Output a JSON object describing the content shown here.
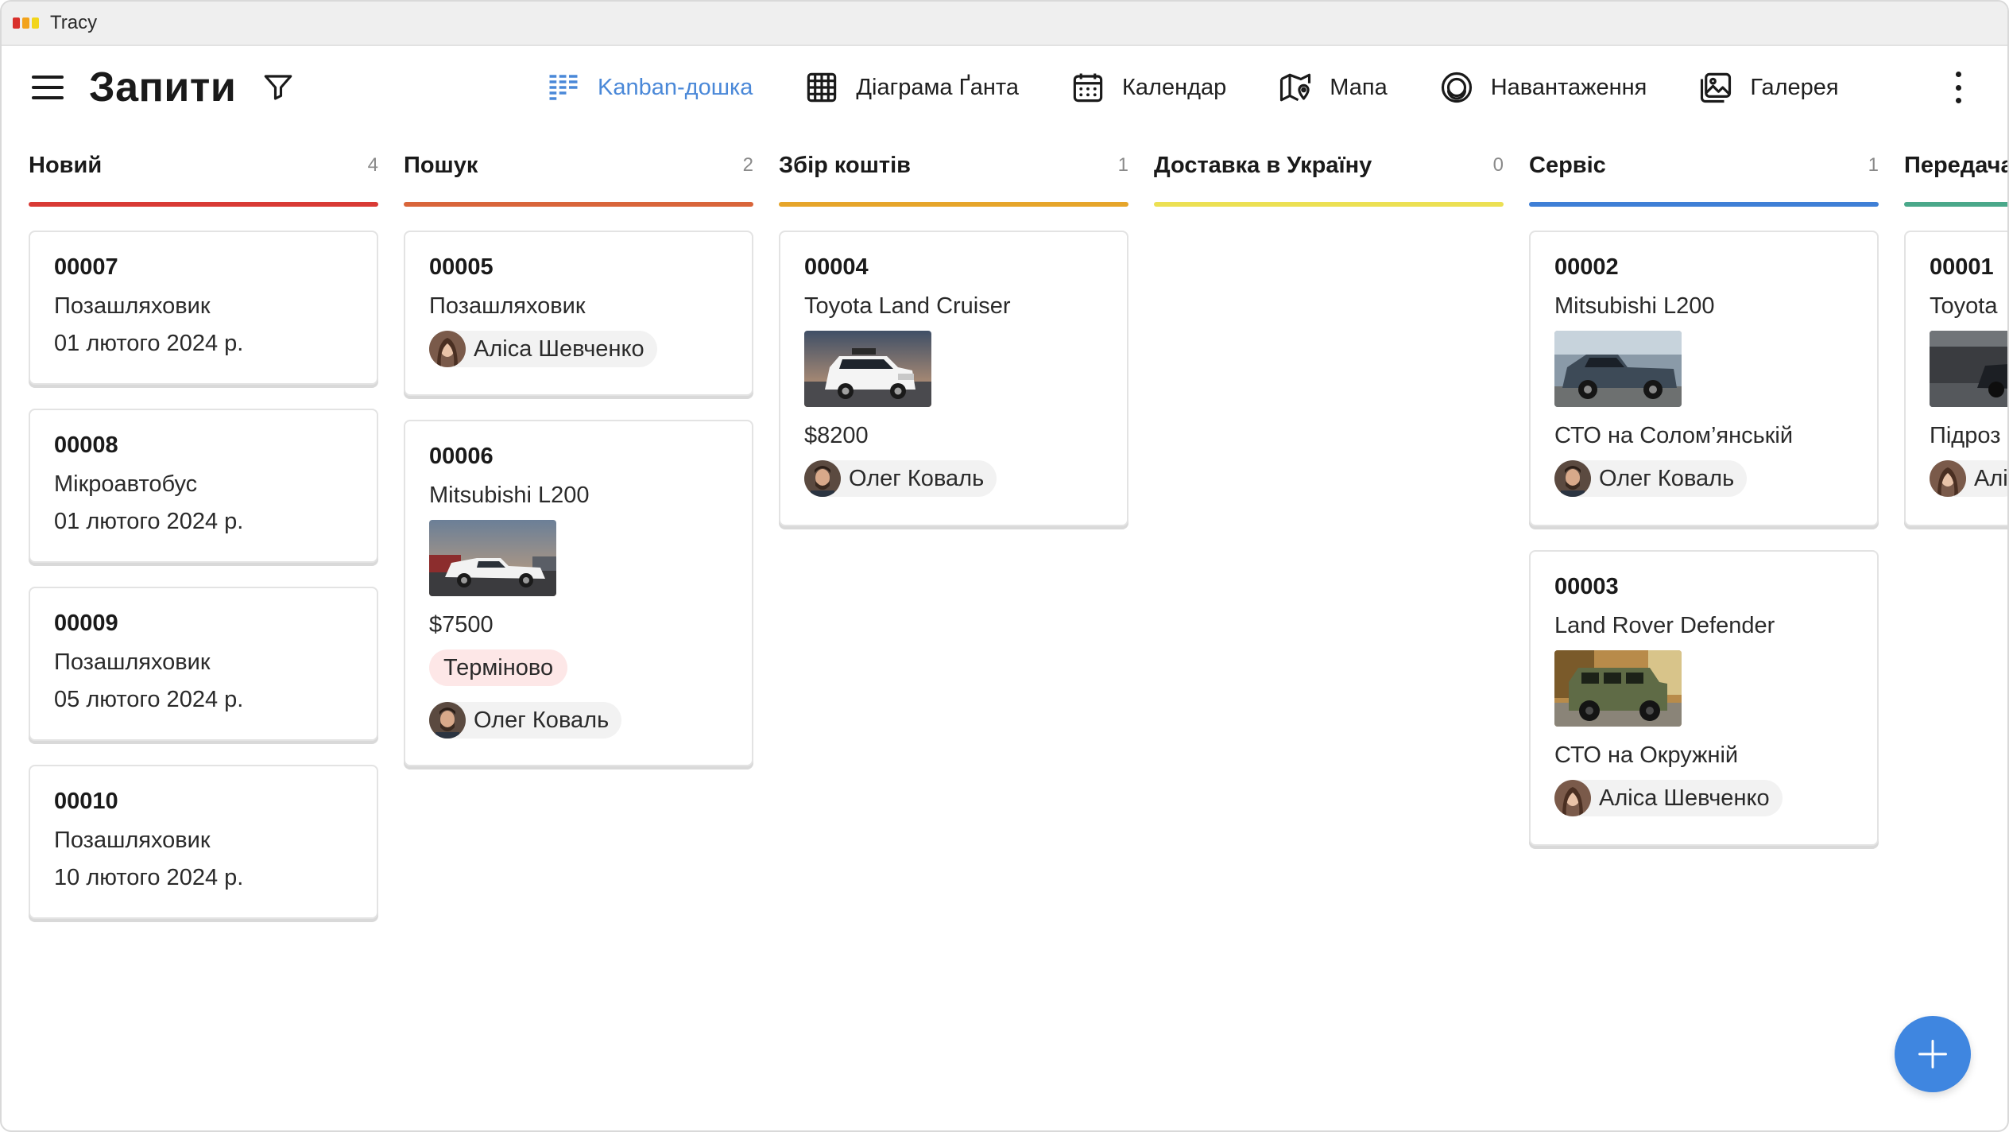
{
  "app": {
    "name": "Tracy",
    "logo_colors": [
      "#d9302c",
      "#f2a31b",
      "#f2d51b"
    ]
  },
  "header": {
    "title": "Запити",
    "views": [
      {
        "label": "Kanban-дошка",
        "icon": "kanban-icon",
        "active": true
      },
      {
        "label": "Діаграма Ґанта",
        "icon": "gantt-grid-icon",
        "active": false
      },
      {
        "label": "Календар",
        "icon": "calendar-icon",
        "active": false
      },
      {
        "label": "Мапа",
        "icon": "map-icon",
        "active": false
      },
      {
        "label": "Навантаження",
        "icon": "workload-icon",
        "active": false
      },
      {
        "label": "Галерея",
        "icon": "gallery-icon",
        "active": false
      }
    ],
    "active_color": "#4a88d8"
  },
  "columns": [
    {
      "title": "Новий",
      "count": "4",
      "color": "#d93a35",
      "cards": [
        {
          "number": "00007",
          "lines": [
            "Позашляховик",
            "01 лютого 2024 р."
          ]
        },
        {
          "number": "00008",
          "lines": [
            "Мікроавтобус",
            "01 лютого 2024 р."
          ]
        },
        {
          "number": "00009",
          "lines": [
            "Позашляховик",
            "05 лютого 2024 р."
          ]
        },
        {
          "number": "00010",
          "lines": [
            "Позашляховик",
            "10 лютого 2024 р."
          ]
        }
      ]
    },
    {
      "title": "Пошук",
      "count": "2",
      "color": "#d9653a",
      "cards": [
        {
          "number": "00005",
          "lines": [
            "Позашляховик"
          ],
          "assignee": "Аліса Шевченко"
        },
        {
          "number": "00006",
          "lines": [
            "Mitsubishi L200"
          ],
          "image": "white-pickup-photo",
          "price": "$7500",
          "tag": "Терміново",
          "assignee": "Олег Коваль"
        }
      ]
    },
    {
      "title": "Збір коштів",
      "count": "1",
      "color": "#e6a52a",
      "cards": [
        {
          "number": "00004",
          "lines": [
            "Toyota Land Cruiser"
          ],
          "image": "white-suv-photo",
          "price": "$8200",
          "assignee": "Олег Коваль"
        }
      ]
    },
    {
      "title": "Доставка в Україну",
      "count": "0",
      "color": "#ece053",
      "cards": []
    },
    {
      "title": "Сервіс",
      "count": "1",
      "color": "#3f7fd6",
      "cards": [
        {
          "number": "00002",
          "lines": [
            "Mitsubishi L200"
          ],
          "image": "gray-pickup-photo",
          "location": "СТО на Солом’янській",
          "assignee": "Олег Коваль"
        },
        {
          "number": "00003",
          "lines": [
            "Land Rover Defender"
          ],
          "image": "green-defender-photo",
          "location": "СТО на Окружній",
          "assignee": "Аліса Шевченко"
        }
      ]
    },
    {
      "title": "Передача",
      "count": "",
      "color": "#4aa88a",
      "cards": [
        {
          "number": "00001",
          "lines": [
            "Toyota"
          ],
          "image": "dark-garage-photo",
          "location": "Підроз",
          "assignee": "Алі"
        }
      ]
    }
  ],
  "fab": {
    "icon": "plus-icon",
    "color": "#3f86e0"
  }
}
